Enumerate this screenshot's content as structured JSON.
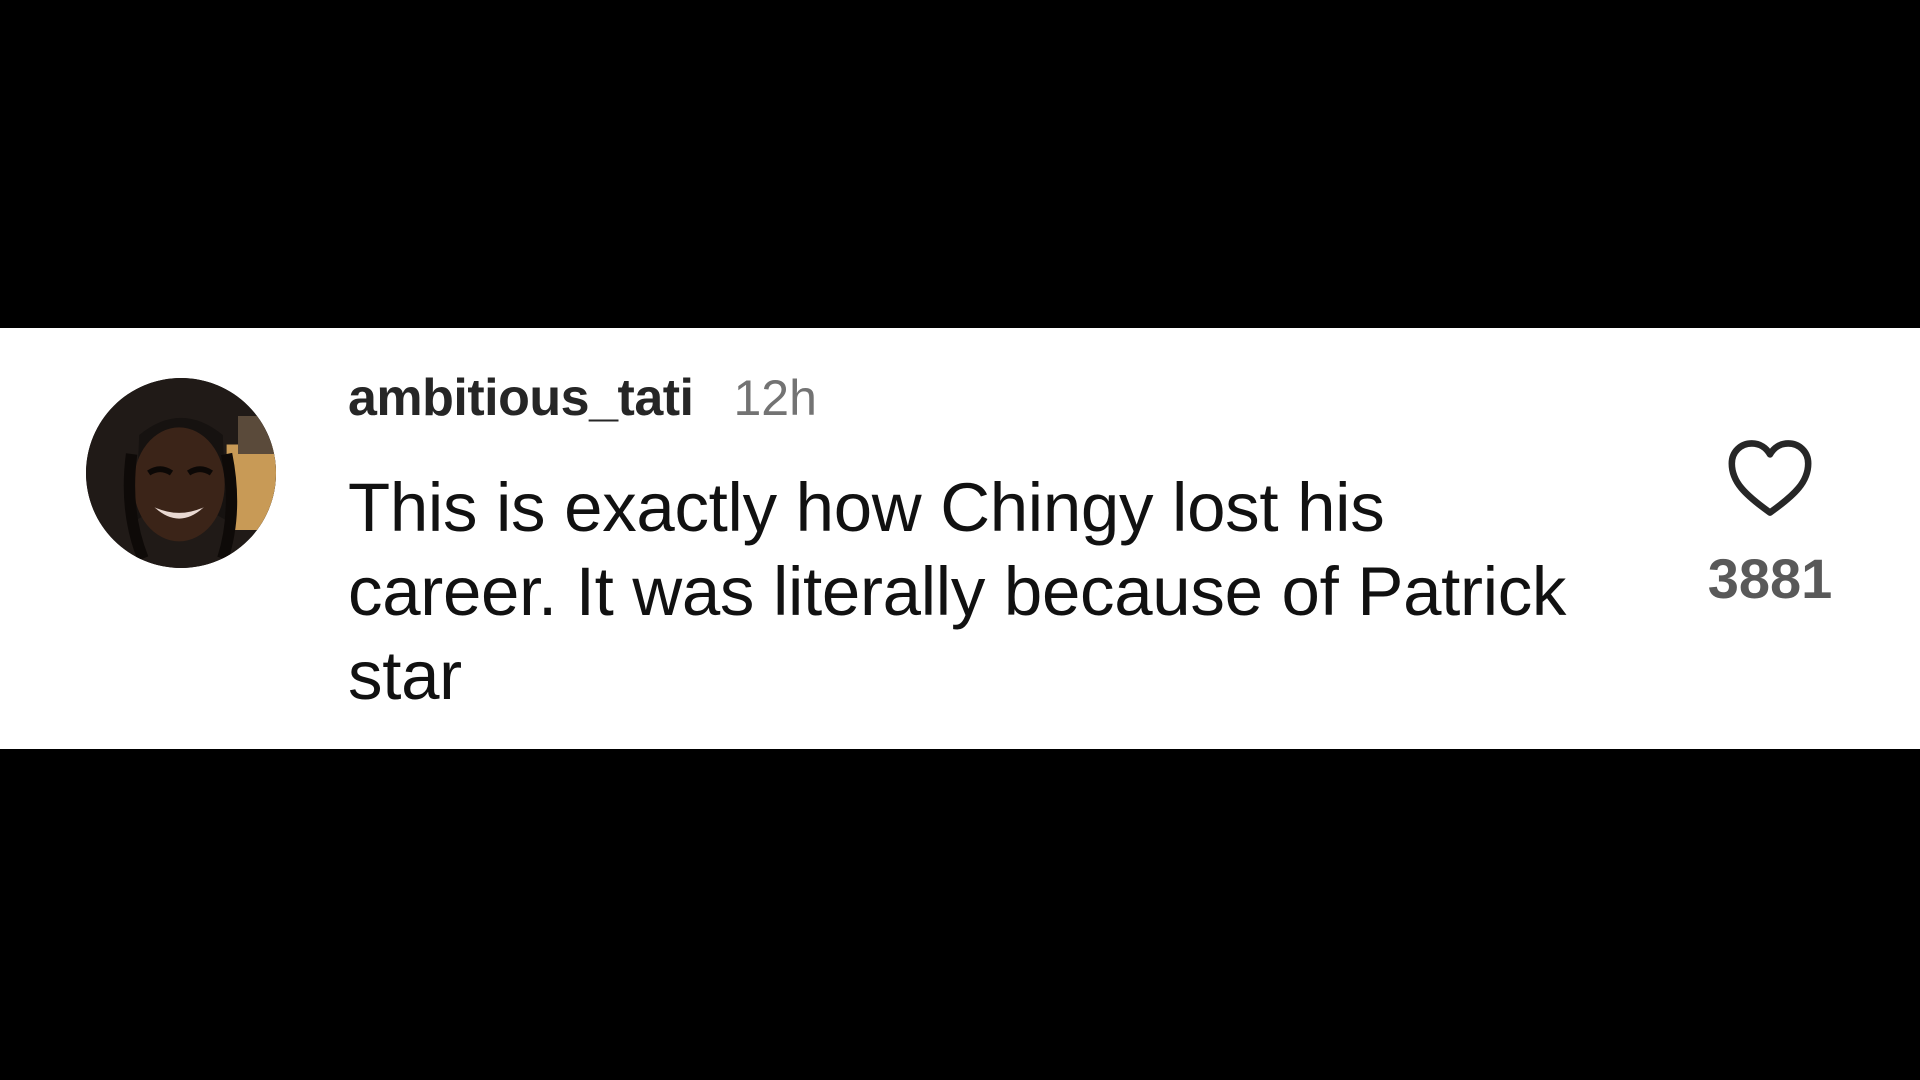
{
  "comment": {
    "username": "ambitious_tati",
    "timestamp": "12h",
    "text": "This is exactly how Chingy lost his career. It was literally because of Patrick star",
    "like_count": "3881"
  },
  "icons": {
    "avatar": "profile-photo",
    "like": "heart-outline-icon"
  },
  "colors": {
    "page_background": "#000000",
    "card_background": "#ffffff",
    "username": "#262626",
    "timestamp": "#737373",
    "like_count": "#595959"
  }
}
